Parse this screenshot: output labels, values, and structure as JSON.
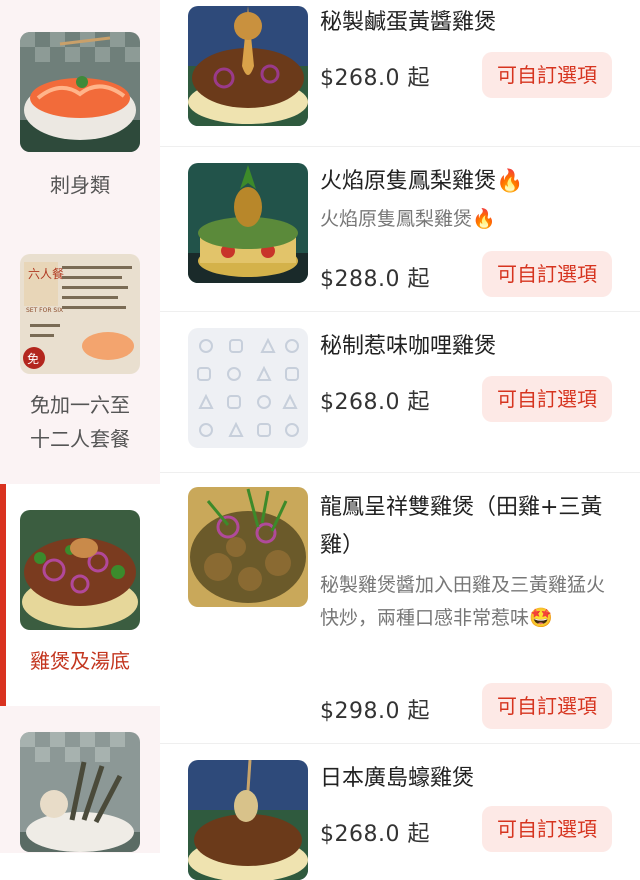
{
  "sidebar": {
    "categories": [
      {
        "label": "刺身類"
      },
      {
        "label": "免加一六至\n十二人套餐"
      },
      {
        "label": "雞煲及湯底"
      },
      {
        "label": ""
      }
    ],
    "set_card_text": {
      "badge": "六人餐",
      "set_for": "SET FOR SIX",
      "free": "免"
    }
  },
  "menu": {
    "items": [
      {
        "name": "秘製鹹蛋黃醬雞煲",
        "desc": "",
        "price": "$268.0 起",
        "button": "可自訂選項"
      },
      {
        "name": "火焰原隻鳳梨雞煲🔥",
        "desc": "火焰原隻鳳梨雞煲🔥",
        "price": "$288.0 起",
        "button": "可自訂選項"
      },
      {
        "name": "秘制惹味咖哩雞煲",
        "desc": "",
        "price": "$268.0 起",
        "button": "可自訂選項"
      },
      {
        "name": "龍鳳呈祥雙雞煲（田雞+三黃雞）",
        "desc": "秘製雞煲醬加入田雞及三黃雞猛火快炒，兩種口感非常惹味🤩",
        "price": "$298.0 起",
        "button": "可自訂選項"
      },
      {
        "name": "日本廣島蠔雞煲",
        "desc": "",
        "price": "$268.0 起",
        "button": "可自訂選項"
      }
    ]
  },
  "colors": {
    "accent": "#d9321f",
    "button_bg": "#fde9e6",
    "sidebar_bg": "#fbf3f4"
  }
}
